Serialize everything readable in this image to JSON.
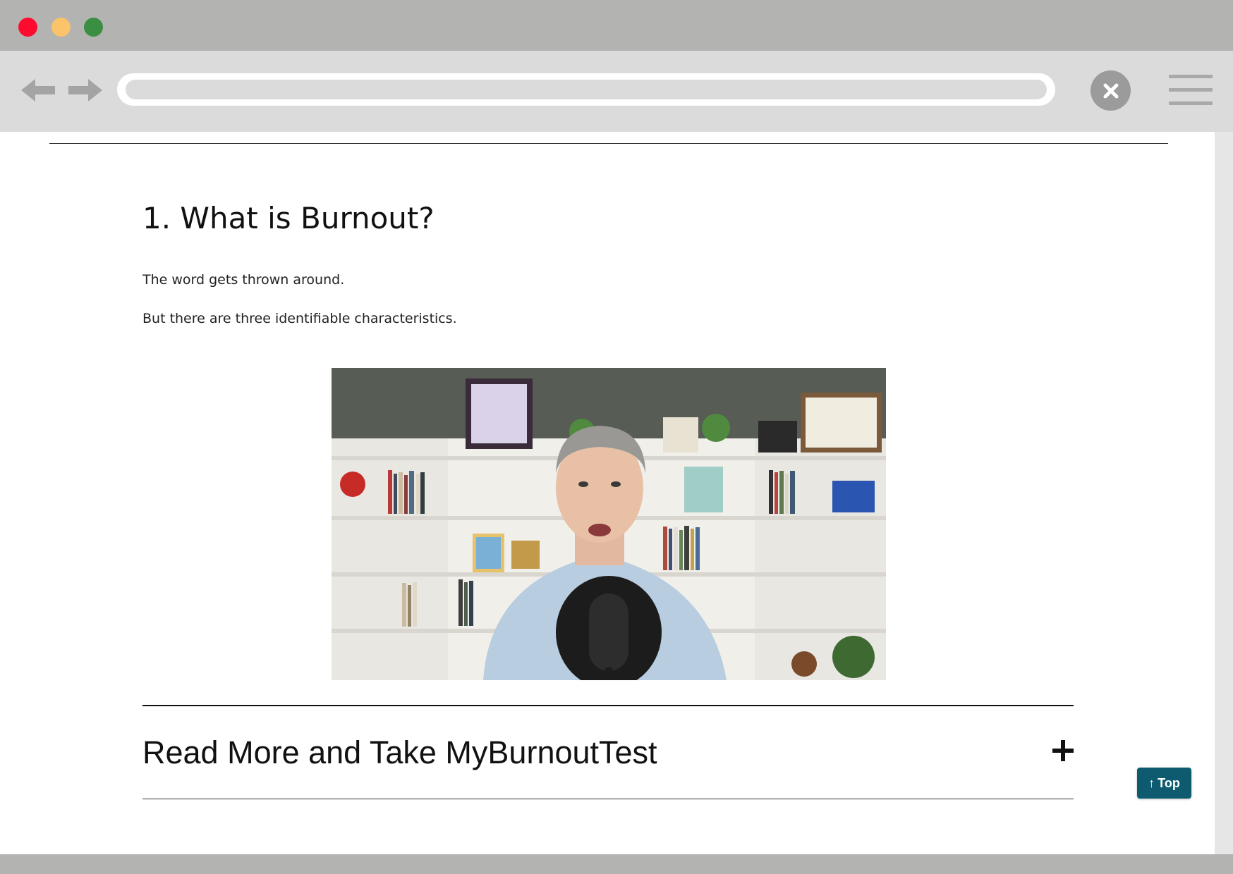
{
  "browser": {
    "url": "",
    "icons": {
      "back": "arrow-left-icon",
      "forward": "arrow-right-icon",
      "close": "close-icon",
      "menu": "hamburger-menu-icon"
    }
  },
  "article": {
    "heading": "1. What is Burnout?",
    "paragraphs": [
      "The word gets thrown around.",
      "But there are three identifiable characteristics."
    ]
  },
  "accordion": {
    "title": "Read More and Take MyBurnoutTest",
    "expanded": false
  },
  "back_to_top": {
    "arrow": "↑",
    "label": "Top",
    "color": "#0e5b6f"
  },
  "colors": {
    "titlebar": "#b3b3b1",
    "toolbar": "#dcdbdc",
    "traffic_red": "#ff0b2f",
    "traffic_yellow": "#fbc36a",
    "traffic_green": "#3b8f43"
  }
}
